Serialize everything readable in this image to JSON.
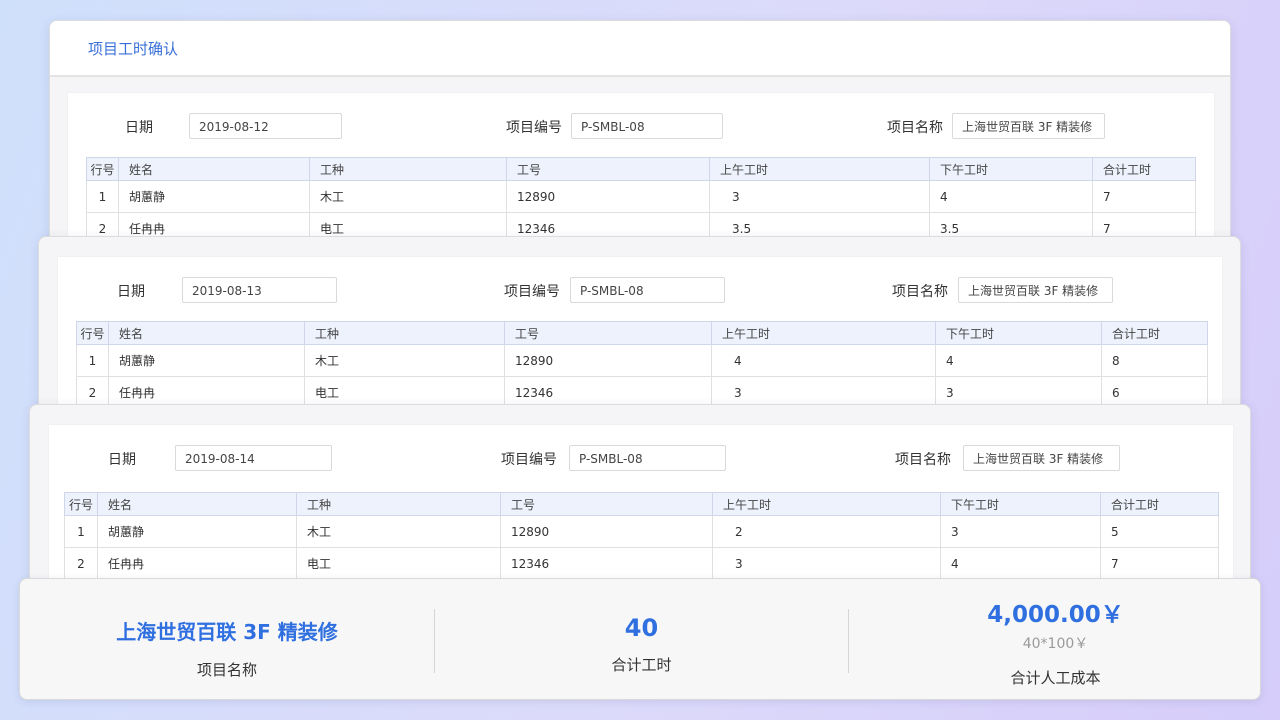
{
  "window": {
    "title": "项目工时确认"
  },
  "labels": {
    "date": "日期",
    "project_no": "项目编号",
    "project_name": "项目名称"
  },
  "columns": [
    "行号",
    "姓名",
    "工种",
    "工号",
    "上午工时",
    "下午工时",
    "合计工时"
  ],
  "cards": [
    {
      "date": "2019-08-12",
      "project_no": "P-SMBL-08",
      "project_name": "上海世贸百联 3F 精装修",
      "rows": [
        [
          "1",
          "胡蕙静",
          "木工",
          "12890",
          "3",
          "4",
          "7"
        ],
        [
          "2",
          "任冉冉",
          "电工",
          "12346",
          "3.5",
          "3.5",
          "7"
        ]
      ]
    },
    {
      "date": "2019-08-13",
      "project_no": "P-SMBL-08",
      "project_name": "上海世贸百联 3F 精装修",
      "rows": [
        [
          "1",
          "胡蕙静",
          "木工",
          "12890",
          "4",
          "4",
          "8"
        ],
        [
          "2",
          "任冉冉",
          "电工",
          "12346",
          "3",
          "3",
          "6"
        ]
      ]
    },
    {
      "date": "2019-08-14",
      "project_no": "P-SMBL-08",
      "project_name": "上海世贸百联 3F 精装修",
      "rows": [
        [
          "1",
          "胡蕙静",
          "木工",
          "12890",
          "2",
          "3",
          "5"
        ],
        [
          "2",
          "任冉冉",
          "电工",
          "12346",
          "3",
          "4",
          "7"
        ]
      ]
    }
  ],
  "summary": {
    "project_name_value": "上海世贸百联 3F 精装修",
    "project_name_label": "项目名称",
    "total_hours_value": "40",
    "total_hours_label": "合计工时",
    "cost_value": "4,000.00￥",
    "cost_formula": "40*100￥",
    "cost_label": "合计人工成本"
  },
  "colors": {
    "accent": "#2f6fe0",
    "header_bg": "#eef2fd"
  }
}
